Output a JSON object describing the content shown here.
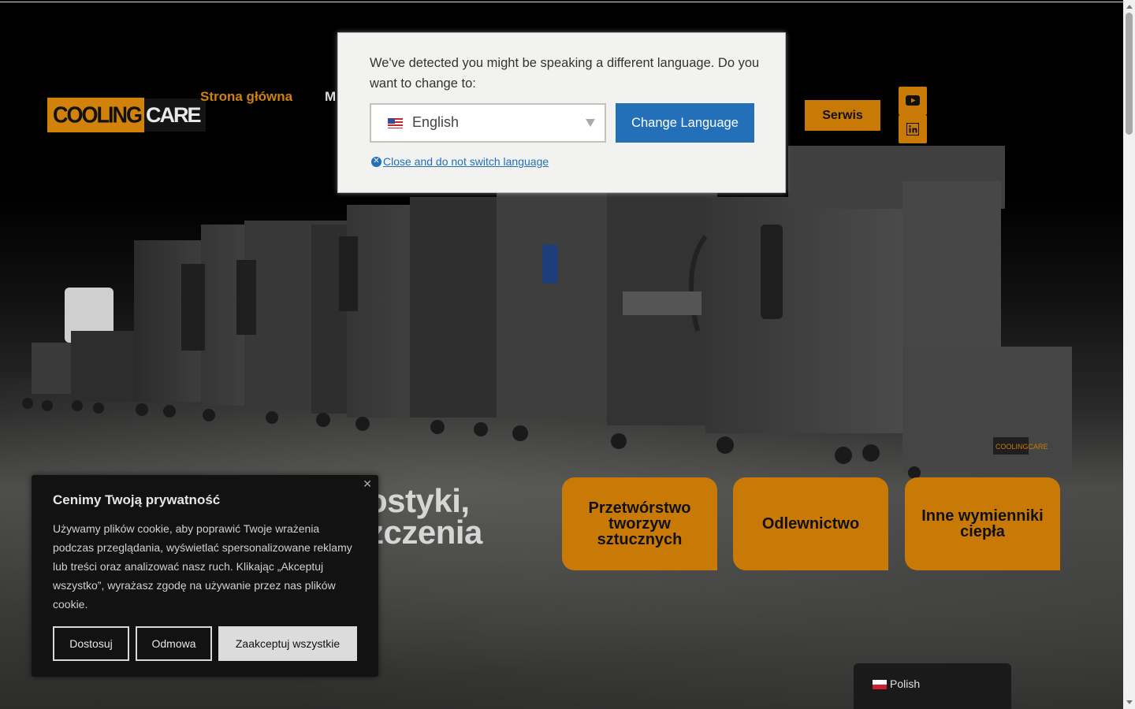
{
  "brand": {
    "logo_part1": "COOLING",
    "logo_part2": "CARE"
  },
  "nav": {
    "home": "Strona główna",
    "partial_item": "M",
    "service_button": "Serwis"
  },
  "social": {
    "youtube_icon": "youtube-icon",
    "linkedin_icon": "linkedin-icon"
  },
  "hero": {
    "heading_line1": "ostyki,",
    "heading_line2": "zczenia"
  },
  "tiles": [
    {
      "label": "Przetwórstwo tworzyw sztucznych"
    },
    {
      "label": "Odlewnictwo"
    },
    {
      "label": "Inne wymienniki ciepła"
    }
  ],
  "language_popup": {
    "message": "We've detected you might be speaking a different language. Do you want to change to:",
    "selected_language": "English",
    "change_button": "Change Language",
    "close_link": "Close and do not switch language"
  },
  "cookie_banner": {
    "title": "Cenimy Twoją prywatność",
    "text": "Używamy plików cookie, aby poprawić Twoje wrażenia podczas przeglądania, wyświetlać spersonalizowane reklamy lub treści oraz analizować nasz ruch. Klikając „Akceptuj wszystko”, wyrażasz zgodę na używanie przez nas plików cookie.",
    "customize_button": "Dostosuj",
    "reject_button": "Odmowa",
    "accept_button": "Zaakceptuj wszystkie",
    "close_symbol": "✕"
  },
  "language_switcher": {
    "current": "Polish"
  },
  "colors": {
    "accent": "#c97a06",
    "popup_button": "#2470b8"
  }
}
